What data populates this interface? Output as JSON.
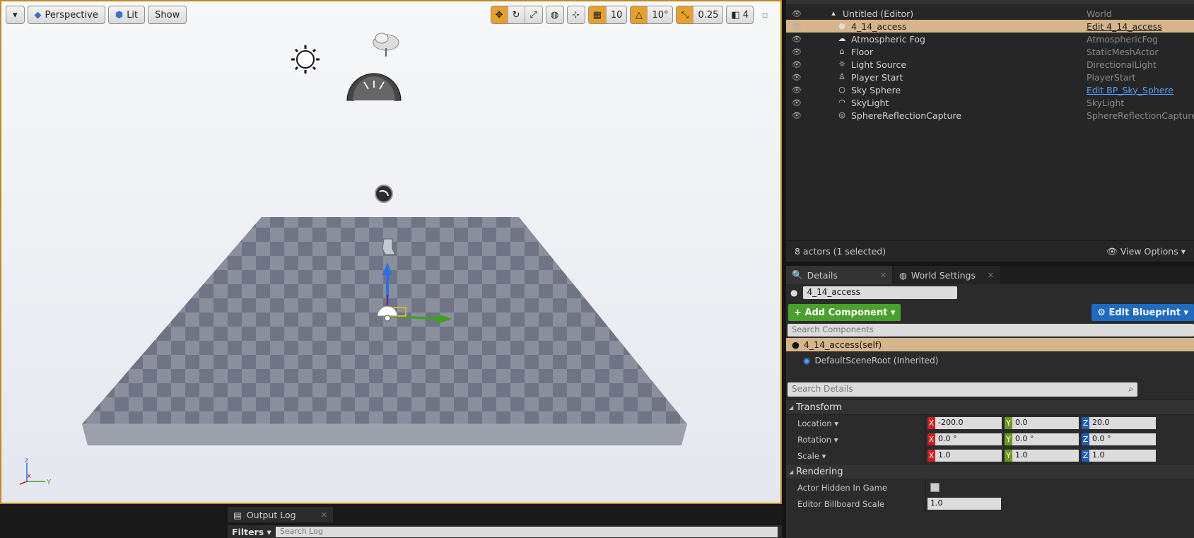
{
  "viewport": {
    "perspective_label": "Perspective",
    "lit_label": "Lit",
    "show_label": "Show",
    "grid_snap": "10",
    "rotation_snap": "10°",
    "scale_snap": "0.25",
    "camera_speed": "4"
  },
  "outliner": {
    "rows": [
      {
        "label": "Untitled (Editor)",
        "type": "World",
        "icon": "world-icon"
      },
      {
        "label": "4_14_access",
        "type": "Edit 4_14_access",
        "icon": "sphere-icon"
      },
      {
        "label": "Atmospheric Fog",
        "type": "AtmosphericFog",
        "icon": "fog-icon"
      },
      {
        "label": "Floor",
        "type": "StaticMeshActor",
        "icon": "floor-icon"
      },
      {
        "label": "Light Source",
        "type": "DirectionalLight",
        "icon": "sun-icon"
      },
      {
        "label": "Player Start",
        "type": "PlayerStart",
        "icon": "player-icon"
      },
      {
        "label": "Sky Sphere",
        "type": "Edit BP_Sky_Sphere",
        "icon": "sphere-icon"
      },
      {
        "label": "SkyLight",
        "type": "SkyLight",
        "icon": "skylight-icon"
      },
      {
        "label": "SphereReflectionCapture",
        "type": "SphereReflectionCapture",
        "icon": "reflection-icon"
      }
    ],
    "actor_count": "8 actors (1 selected)",
    "view_options": "View Options"
  },
  "details": {
    "tab_details": "Details",
    "tab_world": "World Settings",
    "actor_name": "4_14_access",
    "add_component": "Add Component",
    "edit_blueprint": "Edit Blueprint",
    "search_components": "Search Components",
    "self_item": "4_14_access(self)",
    "root_item": "DefaultSceneRoot (Inherited)",
    "search_details": "Search Details",
    "transform_header": "Transform",
    "location_label": "Location",
    "rotation_label": "Rotation",
    "scale_label": "Scale",
    "location": {
      "x": "-200.0",
      "y": "0.0",
      "z": "20.0"
    },
    "rotation": {
      "x": "0.0 °",
      "y": "0.0 °",
      "z": "0.0 °"
    },
    "scale": {
      "x": "1.0",
      "y": "1.0",
      "z": "1.0"
    },
    "rendering_header": "Rendering",
    "hidden_label": "Actor Hidden In Game",
    "billboard_label": "Editor Billboard Scale",
    "billboard_value": "1.0"
  },
  "output_log": {
    "tab": "Output Log",
    "filters": "Filters",
    "search": "Search Log"
  },
  "colors": {
    "selection": "#d7b58a",
    "accent_orange": "#e6a02e",
    "add_green": "#4aa02c",
    "blueprint_blue": "#1f6bbf"
  }
}
